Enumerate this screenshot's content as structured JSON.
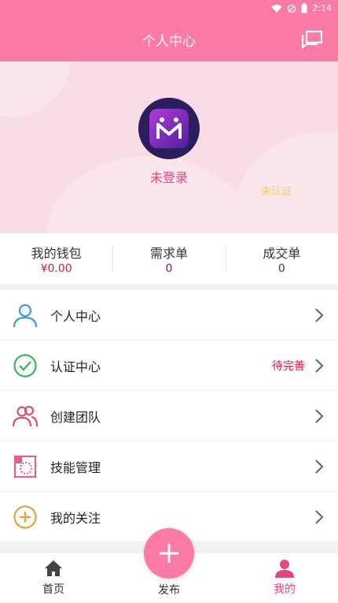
{
  "status_bar": {
    "time": "2:14"
  },
  "header": {
    "title": "个人中心",
    "message_icon": "chat-bubbles-icon"
  },
  "profile": {
    "login_status": "未登录",
    "verify_status": "未认证",
    "avatar_icon": "app-logo-icon"
  },
  "stats": [
    {
      "label": "我的钱包",
      "value": "¥0.00"
    },
    {
      "label": "需求单",
      "value": "0"
    },
    {
      "label": "成交单",
      "value": "0"
    }
  ],
  "menu": [
    {
      "label": "个人中心",
      "icon": "user-icon",
      "badge": ""
    },
    {
      "label": "认证中心",
      "icon": "check-circle-icon",
      "badge": "待完善"
    },
    {
      "label": "创建团队",
      "icon": "team-icon",
      "badge": ""
    },
    {
      "label": "技能管理",
      "icon": "skill-icon",
      "badge": ""
    },
    {
      "label": "我的关注",
      "icon": "plus-circle-icon",
      "badge": ""
    }
  ],
  "tabbar": {
    "home": "首页",
    "publish": "发布",
    "mine": "我的"
  },
  "colors": {
    "brand": "#fb7aa8",
    "accent": "#e2477f",
    "badge": "#d61b49"
  }
}
